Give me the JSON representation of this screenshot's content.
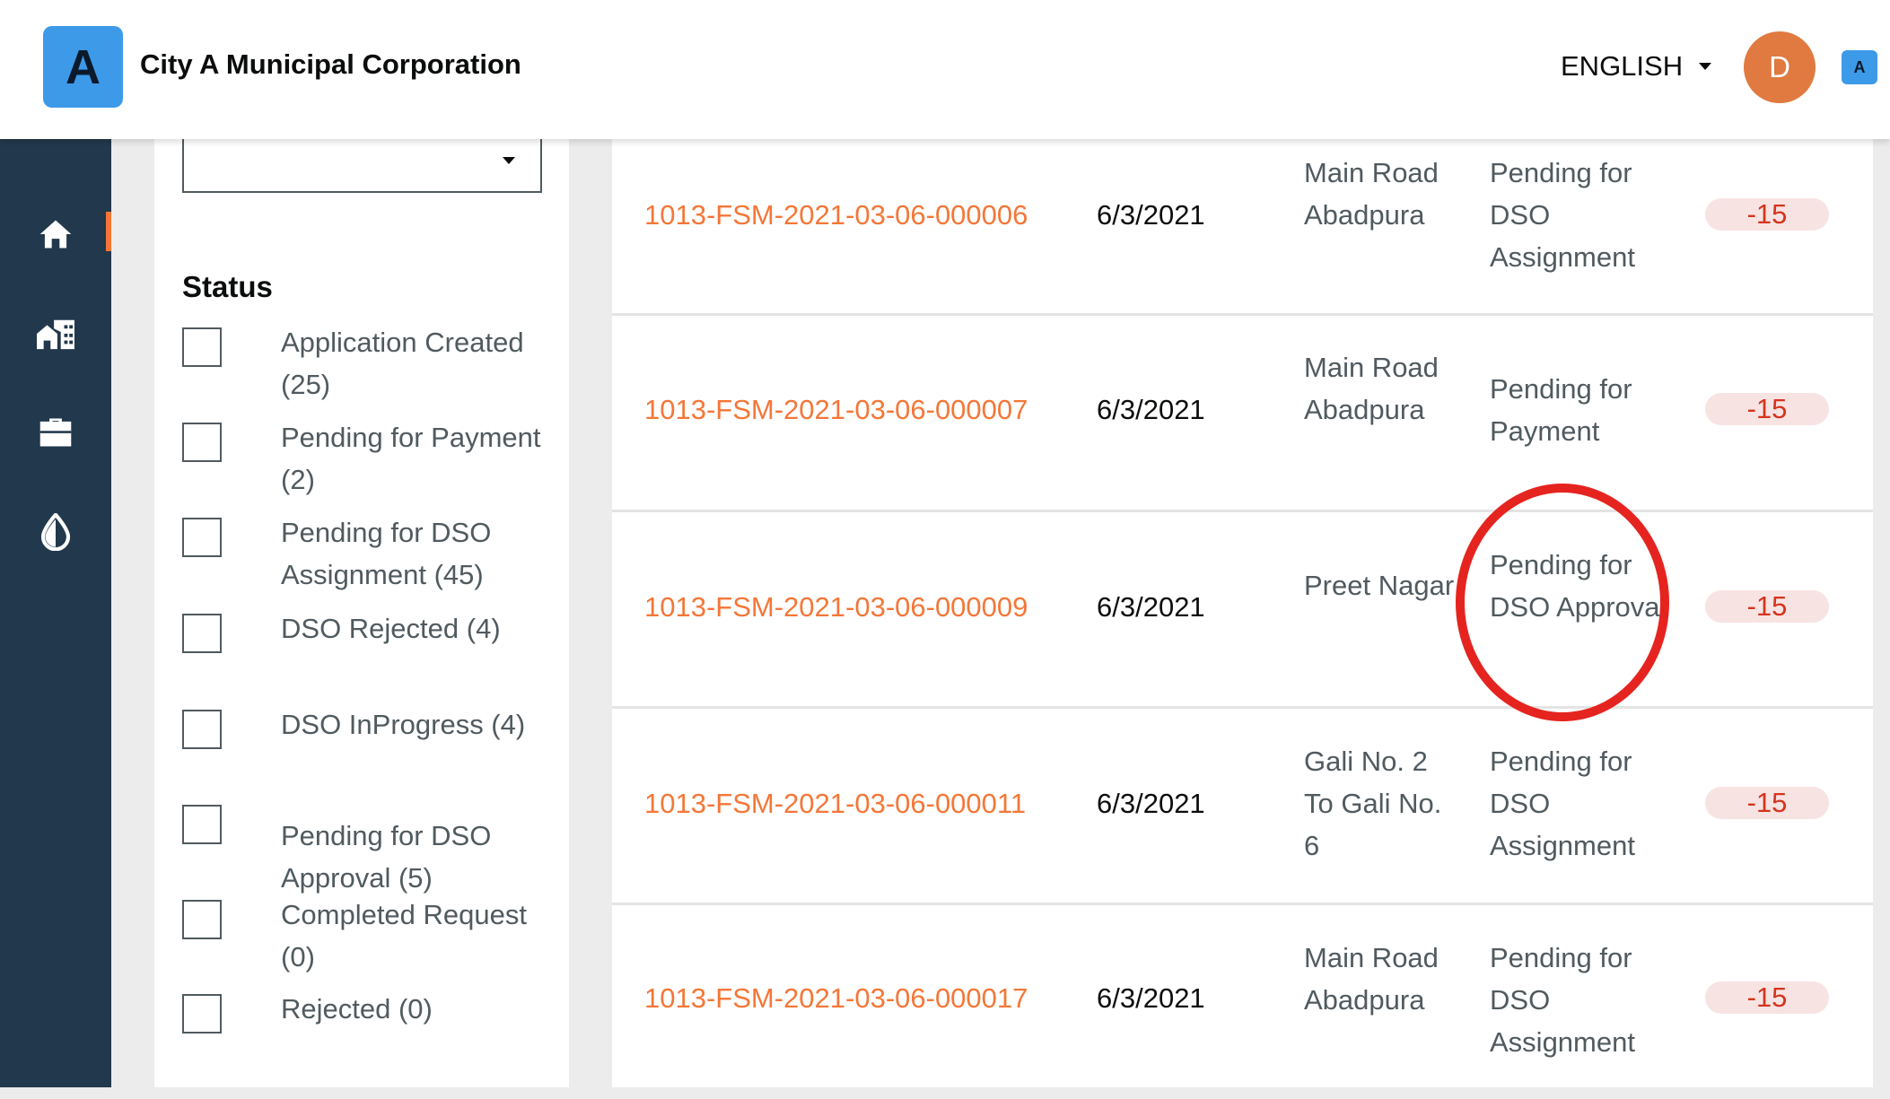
{
  "header": {
    "logo_letter": "A",
    "title": "City A Municipal Corporation",
    "language": "ENGLISH",
    "avatar_initial": "D",
    "mini_logo_letter": "A"
  },
  "sidebar": {
    "items": [
      {
        "icon": "home-icon",
        "active": true
      },
      {
        "icon": "city-icon",
        "active": false
      },
      {
        "icon": "briefcase-icon",
        "active": false
      },
      {
        "icon": "water-drop-icon",
        "active": false
      }
    ]
  },
  "filters": {
    "status_heading": "Status",
    "options": [
      {
        "label": "Application Created (25)"
      },
      {
        "label": "Pending for Payment (2)"
      },
      {
        "label": "Pending for DSO Assignment (45)"
      },
      {
        "label": "DSO Rejected (4)"
      },
      {
        "label": "DSO InProgress (4)"
      },
      {
        "label": "Pending for DSO Approval (5)"
      },
      {
        "label": "Completed Request (0)"
      },
      {
        "label": "Rejected (0)"
      }
    ]
  },
  "table": {
    "rows": [
      {
        "application_no": "1013-FSM-2021-03-06-000006",
        "date": "6/3/2021",
        "locality": "Main Road Abadpura",
        "status": "Pending for DSO Assignment",
        "sla": "-15"
      },
      {
        "application_no": "1013-FSM-2021-03-06-000007",
        "date": "6/3/2021",
        "locality": "Main Road Abadpura",
        "status": "Pending for Payment",
        "sla": "-15"
      },
      {
        "application_no": "1013-FSM-2021-03-06-000009",
        "date": "6/3/2021",
        "locality": "Preet Nagar",
        "status": "Pending for DSO Approval",
        "sla": "-15"
      },
      {
        "application_no": "1013-FSM-2021-03-06-000011",
        "date": "6/3/2021",
        "locality": "Gali No. 2 To Gali No. 6",
        "status": "Pending for DSO Assignment",
        "sla": "-15"
      },
      {
        "application_no": "1013-FSM-2021-03-06-000017",
        "date": "6/3/2021",
        "locality": "Main Road Abadpura",
        "status": "Pending for DSO Assignment",
        "sla": "-15"
      }
    ]
  },
  "colors": {
    "accent": "#f47738",
    "sidebar": "#22384c",
    "logo": "#3d9ae8",
    "avatar": "#e07a40",
    "sla_text": "#d4351c",
    "sla_bg": "#f8e3e3",
    "annotation": "#e52420"
  }
}
